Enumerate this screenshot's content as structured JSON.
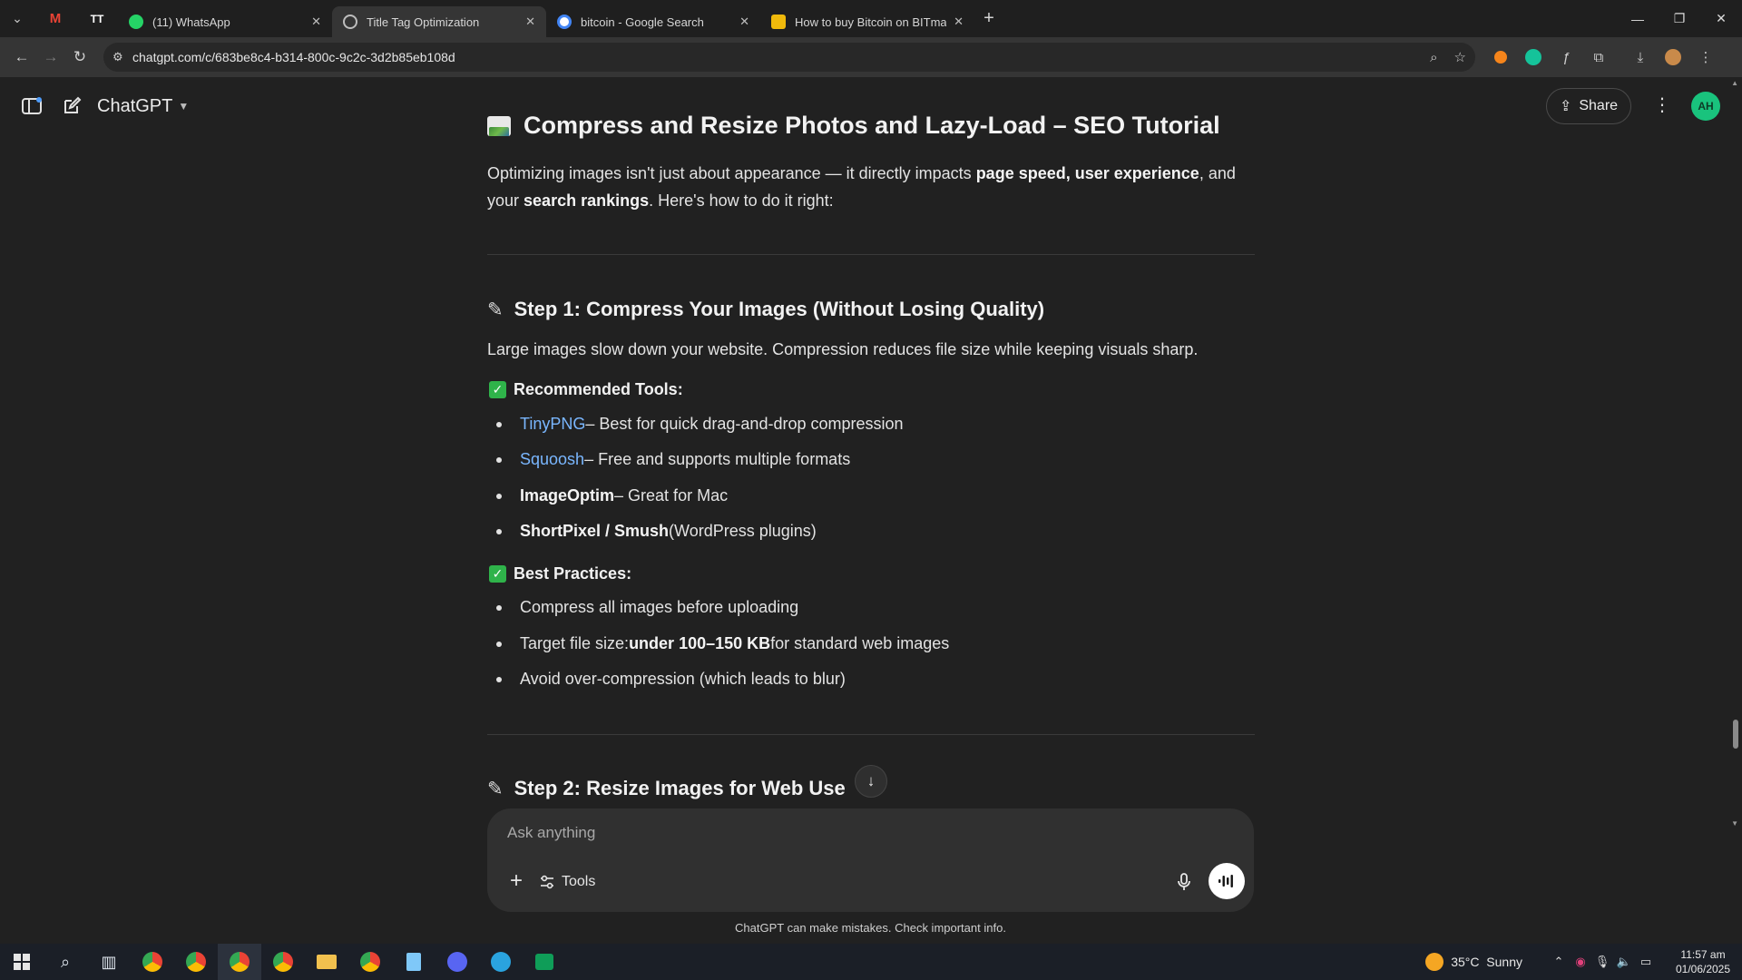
{
  "browser": {
    "tabs": [
      {
        "label": "(11) WhatsApp",
        "color": "#25d366",
        "active": false
      },
      {
        "label": "Title Tag Optimization",
        "color": "#bdbdbd",
        "active": true
      },
      {
        "label": "bitcoin - Google Search",
        "color": "#4285f4",
        "active": false
      },
      {
        "label": "How to buy Bitcoin on BITmark",
        "color": "#f0b90b",
        "active": false
      }
    ],
    "url": "chatgpt.com/c/683be8c4-b314-800c-9c2c-3d2b85eb108d"
  },
  "app": {
    "model_name": "ChatGPT",
    "share_label": "Share",
    "avatar_initials": "AH"
  },
  "article": {
    "title": "Compress and Resize Photos and Lazy-Load – SEO Tutorial",
    "intro_1": "Optimizing images isn't just about appearance — it directly impacts ",
    "intro_bold_1": "page speed, user experience",
    "intro_2": ", and your ",
    "intro_bold_2": "search rankings",
    "intro_3": ". Here's how to do it right:",
    "step1_title": "Step 1: Compress Your Images (Without Losing Quality)",
    "step1_desc": "Large images slow down your website. Compression reduces file size while keeping visuals sharp.",
    "tools_heading": "Recommended Tools:",
    "tools": [
      {
        "name": "TinyPNG",
        "desc": " – Best for quick drag-and-drop compression"
      },
      {
        "name": "Squoosh",
        "desc": " – Free and supports multiple formats"
      },
      {
        "name": "ImageOptim",
        "desc": " – Great for Mac"
      },
      {
        "name": "ShortPixel / Smush",
        "desc": " (WordPress plugins)"
      }
    ],
    "practices_heading": "Best Practices:",
    "practice_1": "Compress all images before uploading",
    "practice_2_pre": "Target file size: ",
    "practice_2_bold": "under 100–150 KB",
    "practice_2_post": " for standard web images",
    "practice_3": "Avoid over-compression (which leads to blur)",
    "step2_title": "Step 2: Resize Images for Web Use"
  },
  "composer": {
    "placeholder": "Ask anything",
    "tools_label": "Tools",
    "disclaimer": "ChatGPT can make mistakes. Check important info."
  },
  "taskbar": {
    "temperature": "35°C",
    "condition": "Sunny",
    "time": "11:57 am",
    "date": "01/06/2025"
  }
}
